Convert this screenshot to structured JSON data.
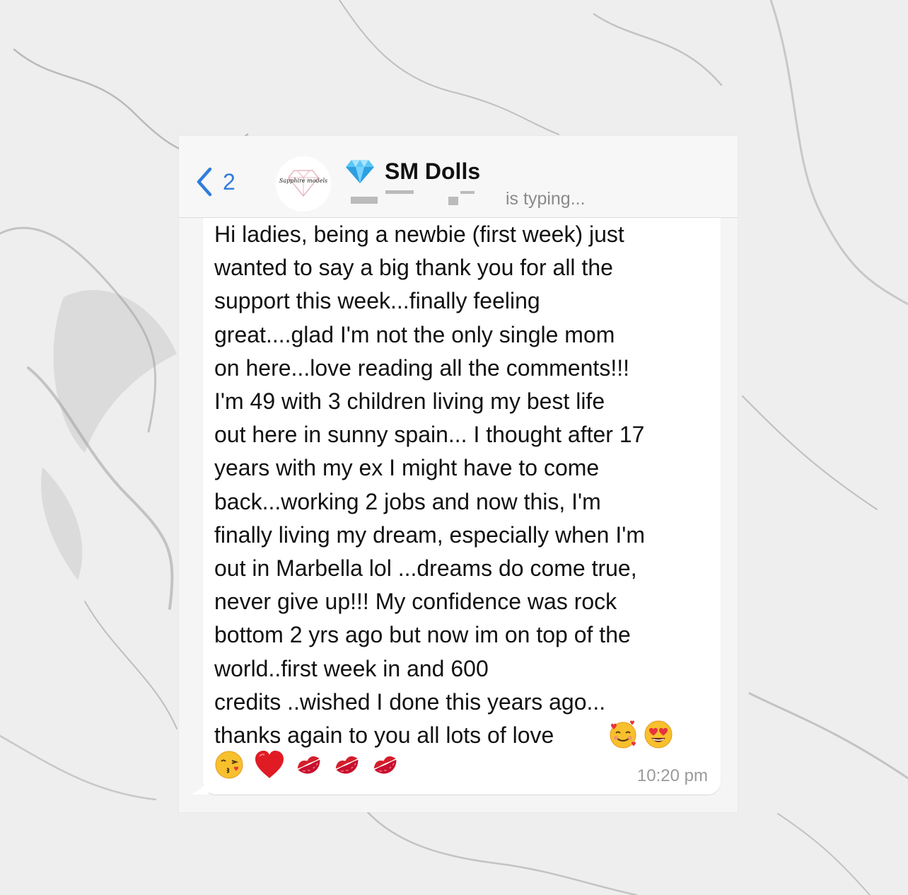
{
  "header": {
    "back_count": "2",
    "chat_title": "SM Dolls",
    "avatar_text": "Sapphire models",
    "typing_status": "is typing..."
  },
  "message": {
    "text": "Hi ladies, being a newbie (first week) just\nwanted to say a big thank you for all the\nsupport this week...finally feeling\ngreat....glad I'm not the only single mom\non here...love reading all the comments!!!\nI'm 49 with 3 children living my best life\nout here in sunny spain... I thought after 17\nyears with my ex I might have to come\nback...working 2 jobs and now this, I'm\nfinally living my dream, especially when I'm\nout in Marbella lol ...dreams do come true,\nnever give up!!! My confidence was rock\nbottom 2 yrs ago but now im on top of the\nworld..first week in and 600\ncredits ..wished I done this years ago...\nthanks again to you all lots of love",
    "time": "10:20 pm"
  },
  "icons": [
    "chevron-left-icon",
    "gem-icon",
    "smiling-face-with-hearts-icon",
    "heart-eyes-icon",
    "kissing-face-icon",
    "red-heart-icon",
    "kiss-mark-icon"
  ],
  "colors": {
    "accent": "#2f7ddc",
    "bubble": "#ffffff",
    "header": "#f7f7f7"
  }
}
